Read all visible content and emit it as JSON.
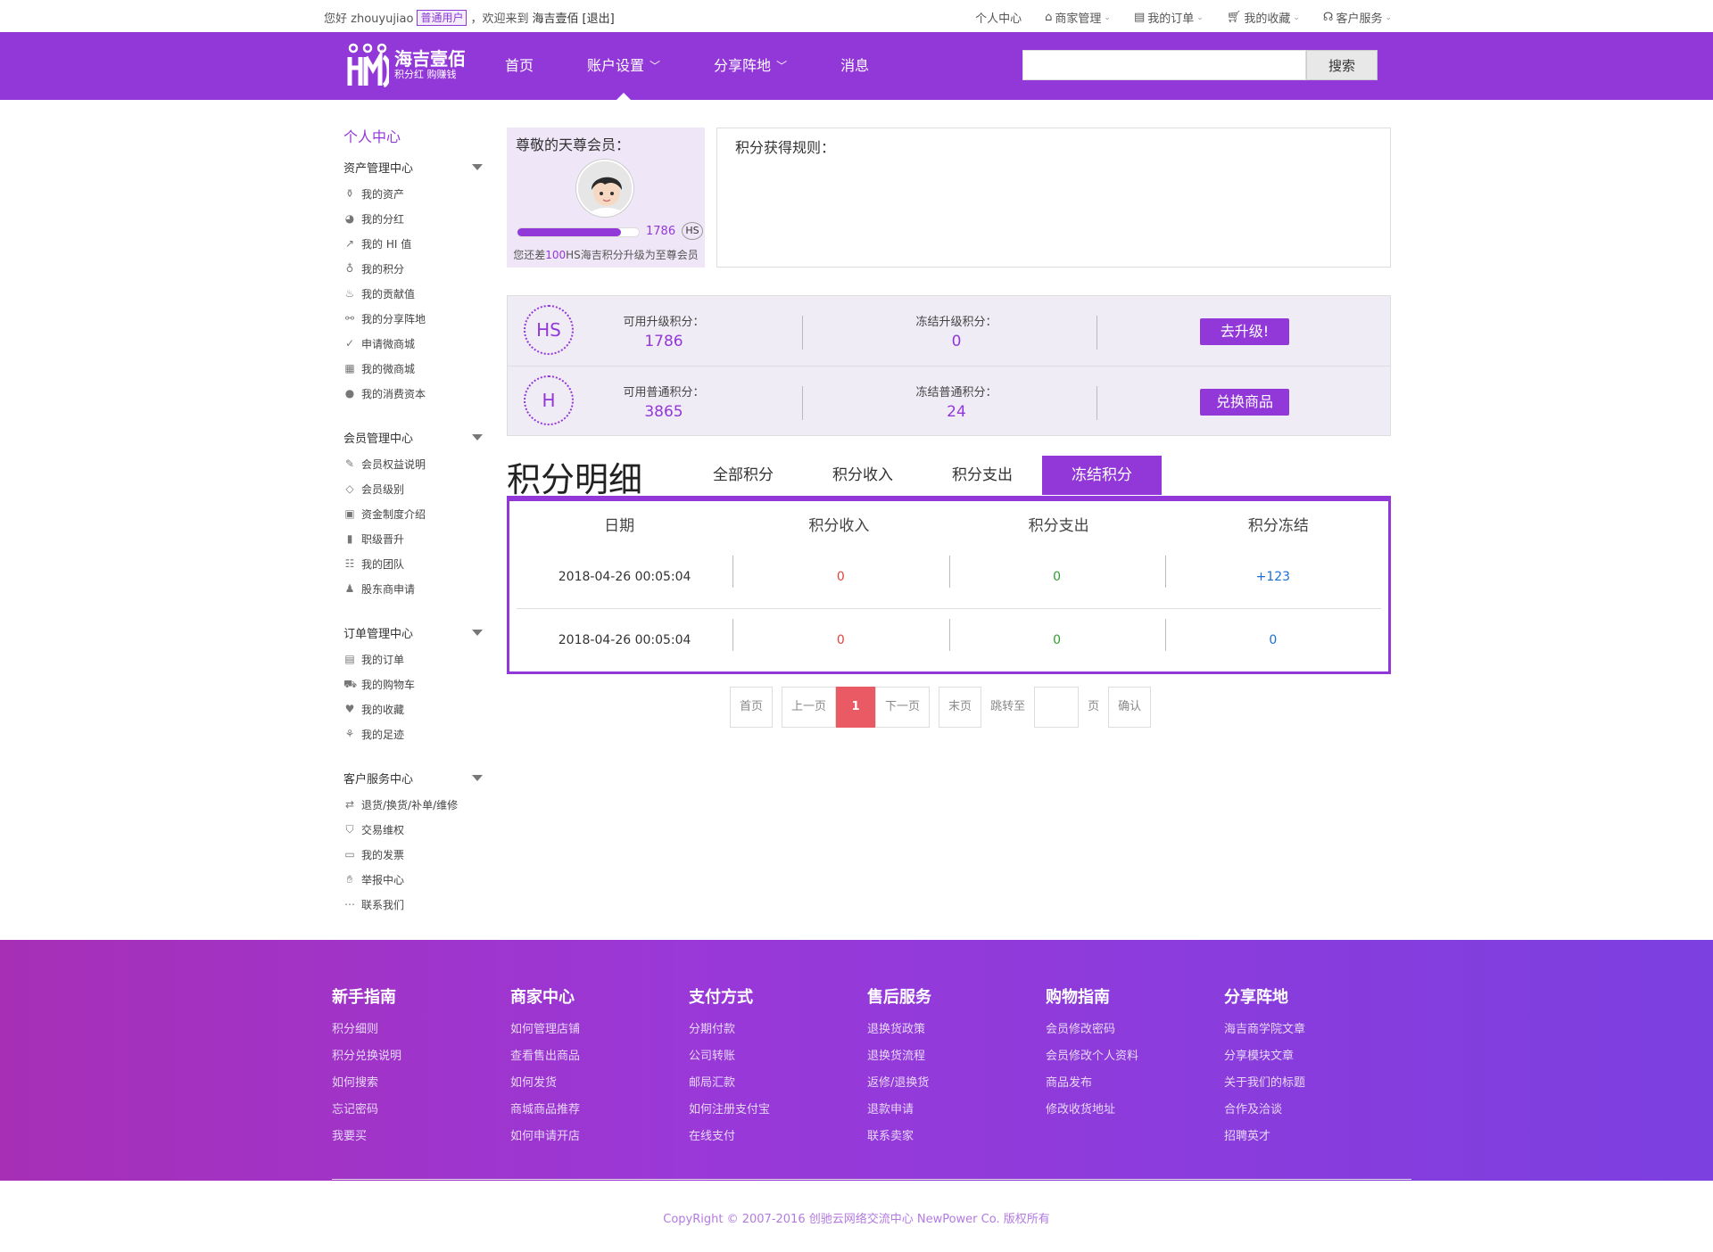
{
  "topbar": {
    "greeting": "您好 zhouyujiao",
    "role": "普通用户",
    "welcome": "，欢迎来到",
    "site": "海吉壹佰",
    "logout": "[退出]",
    "links": [
      "个人中心",
      "商家管理",
      "我的订单",
      "我的收藏",
      "客户服务"
    ]
  },
  "logo": {
    "name": "海吉壹佰",
    "slogan": "积分红 购赚钱"
  },
  "nav": {
    "items": [
      "首页",
      "账户设置",
      "分享阵地",
      "消息"
    ]
  },
  "search": {
    "button": "搜索",
    "value": ""
  },
  "sidebar": {
    "home": "个人中心",
    "groups": [
      {
        "title": "资产管理中心",
        "items": [
          "我的资产",
          "我的分红",
          "我的 HI 值",
          "我的积分",
          "我的贡献值",
          "我的分享阵地",
          "申请微商城",
          "我的微商城",
          "我的消费资本"
        ]
      },
      {
        "title": "会员管理中心",
        "items": [
          "会员权益说明",
          "会员级别",
          "资金制度介绍",
          "职级晋升",
          "我的团队",
          "股东商申请"
        ]
      },
      {
        "title": "订单管理中心",
        "items": [
          "我的订单",
          "我的购物车",
          "我的收藏",
          "我的足迹"
        ]
      },
      {
        "title": "客户服务中心",
        "items": [
          "退货/换货/补单/维修",
          "交易维权",
          "我的发票",
          "举报中心",
          "联系我们"
        ]
      }
    ]
  },
  "member": {
    "title": "尊敬的天尊会员：",
    "points": "1786",
    "badge": "HS",
    "progress": 0.85,
    "tip_prefix": "您还差",
    "tip_num": "100",
    "tip_suffix": "HS海吉积分升级为至尊会员"
  },
  "rules": {
    "title": "积分获得规则："
  },
  "points": [
    {
      "seal": "HS",
      "label1": "可用升级积分：",
      "value1": "1786",
      "label2": "冻结升级积分：",
      "value2": "0",
      "button": "去升级!"
    },
    {
      "seal": "H",
      "label1": "可用普通积分：",
      "value1": "3865",
      "label2": "冻结普通积分：",
      "value2": "24",
      "button": "兑换商品"
    }
  ],
  "detail": {
    "title": "积分明细",
    "tabs": [
      "全部积分",
      "积分收入",
      "积分支出",
      "冻结积分"
    ],
    "columns": [
      "日期",
      "积分收入",
      "积分支出",
      "积分冻结"
    ],
    "rows": [
      [
        "2018-04-26 00:05:04",
        "0",
        "0",
        "+123"
      ],
      [
        "2018-04-26 00:05:04",
        "0",
        "0",
        "0"
      ]
    ]
  },
  "pager": {
    "first": "首页",
    "prev": "上一页",
    "current": "1",
    "next": "下一页",
    "last": "末页",
    "jump": "跳转至",
    "page": "页",
    "confirm": "确认"
  },
  "footer": {
    "columns": [
      {
        "title": "新手指南",
        "links": [
          "积分细则",
          "积分兑换说明",
          "如何搜索",
          "忘记密码",
          "我要买"
        ]
      },
      {
        "title": "商家中心",
        "links": [
          "如何管理店铺",
          "查看售出商品",
          "如何发货",
          "商城商品推荐",
          "如何申请开店"
        ]
      },
      {
        "title": "支付方式",
        "links": [
          "分期付款",
          "公司转账",
          "邮局汇款",
          "如何注册支付宝",
          "在线支付"
        ]
      },
      {
        "title": "售后服务",
        "links": [
          "退换货政策",
          "退换货流程",
          "返修/退换货",
          "退款申请",
          "联系卖家"
        ]
      },
      {
        "title": "购物指南",
        "links": [
          "会员修改密码",
          "会员修改个人资料",
          "商品发布",
          "修改收货地址"
        ]
      },
      {
        "title": "分享阵地",
        "links": [
          "海吉商学院文章",
          "分享模块文章",
          "关于我们的标题",
          "合作及洽谈",
          "招聘英才"
        ]
      }
    ],
    "copyright": "CopyRight © 2007-2016 创驰云网络交流中心 NewPower Co. 版权所有"
  },
  "colors": {
    "brand": "#9338d8",
    "pager_current": "#ea5a64"
  }
}
